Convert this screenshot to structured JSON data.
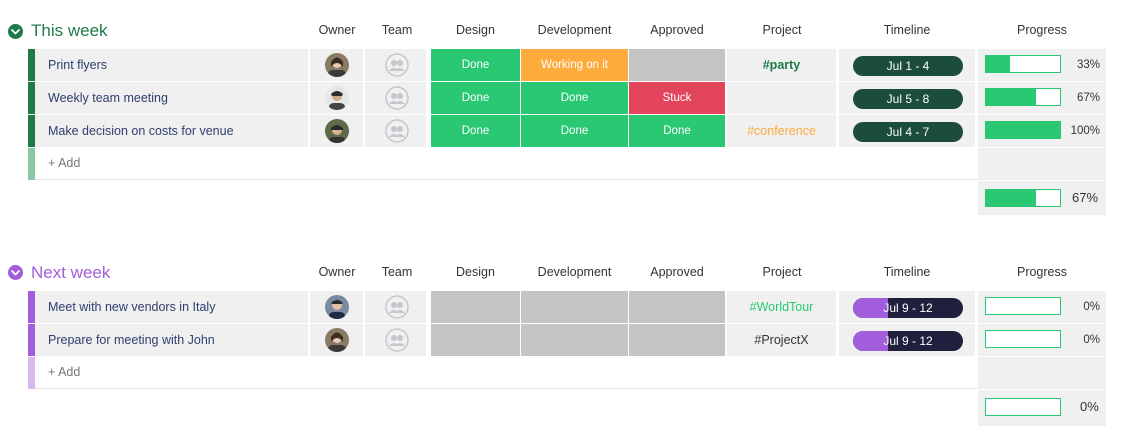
{
  "columns": {
    "owner": "Owner",
    "team": "Team",
    "design": "Design",
    "development": "Development",
    "approved": "Approved",
    "project": "Project",
    "timeline": "Timeline",
    "progress": "Progress"
  },
  "colors": {
    "done": "#2bc874",
    "working": "#fdab3d",
    "stuck": "#e2445c",
    "empty": "#c4c4c4",
    "group1": "#1f7a4a",
    "group2": "#a25ddc",
    "timeline_dark": "#1c4d3a",
    "timeline_navy": "#1f1f3e"
  },
  "groups": [
    {
      "title": "This week",
      "add_label": "+ Add",
      "summary_progress": "67%",
      "summary_progress_value": 0.67,
      "rows": [
        {
          "name": "Print flyers",
          "design": "Done",
          "development": "Working on it",
          "approved": "",
          "project": "#party",
          "project_color": "#1f7a4a",
          "timeline": "Jul 1 - 4",
          "progress": "33%",
          "progress_value": 0.33
        },
        {
          "name": "Weekly team meeting",
          "design": "Done",
          "development": "Done",
          "approved": "Stuck",
          "project": "",
          "project_color": "#1f7a4a",
          "timeline": "Jul 5 - 8",
          "progress": "67%",
          "progress_value": 0.67
        },
        {
          "name": "Make decision on costs for venue",
          "design": "Done",
          "development": "Done",
          "approved": "Done",
          "project": "#conference",
          "project_color": "#fdab3d",
          "timeline": "Jul 4 - 7",
          "progress": "100%",
          "progress_value": 1.0
        }
      ]
    },
    {
      "title": "Next week",
      "add_label": "+ Add",
      "summary_progress": "0%",
      "summary_progress_value": 0,
      "rows": [
        {
          "name": "Meet with new vendors in Italy",
          "design": "",
          "development": "",
          "approved": "",
          "project": "#WorldTour",
          "project_color": "#2bc874",
          "timeline": "Jul 9 - 12",
          "progress": "0%",
          "progress_value": 0,
          "timeline_split": 0.32
        },
        {
          "name": "Prepare for meeting with John",
          "design": "",
          "development": "",
          "approved": "",
          "project": "#ProjectX",
          "project_color": "#323338",
          "timeline": "Jul 9 - 12",
          "progress": "0%",
          "progress_value": 0,
          "timeline_split": 0.32
        }
      ]
    }
  ]
}
